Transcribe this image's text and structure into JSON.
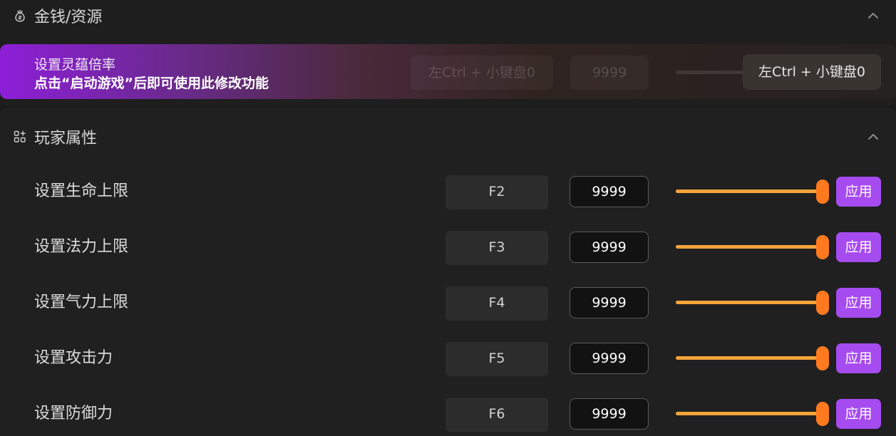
{
  "money_section": {
    "title": "金钱/资源",
    "icon": "money-bag-icon",
    "expanded": true,
    "banner": {
      "title": "设置灵蕴倍率",
      "notice": "点击“启动游戏”后即可使用此修改功能",
      "ghost_hotkey": "左Ctrl + 小键盘0",
      "ghost_value": "9999",
      "hotkey": "左Ctrl + 小键盘0"
    }
  },
  "player_section": {
    "title": "玩家属性",
    "icon": "attributes-grid-icon",
    "expanded": true,
    "rows": [
      {
        "label": "设置生命上限",
        "hotkey": "F2",
        "value": "9999",
        "slider_level": 1.0,
        "apply_label": "应用"
      },
      {
        "label": "设置法力上限",
        "hotkey": "F3",
        "value": "9999",
        "slider_level": 1.0,
        "apply_label": "应用"
      },
      {
        "label": "设置气力上限",
        "hotkey": "F4",
        "value": "9999",
        "slider_level": 1.0,
        "apply_label": "应用"
      },
      {
        "label": "设置攻击力",
        "hotkey": "F5",
        "value": "9999",
        "slider_level": 1.0,
        "apply_label": "应用"
      },
      {
        "label": "设置防御力",
        "hotkey": "F6",
        "value": "9999",
        "slider_level": 1.0,
        "apply_label": "应用"
      }
    ]
  },
  "colors": {
    "accent": "#a64bf0",
    "slider_fill": "#f6a43a",
    "slider_thumb": "#ff7a1f",
    "background": "#1b1b1b"
  }
}
